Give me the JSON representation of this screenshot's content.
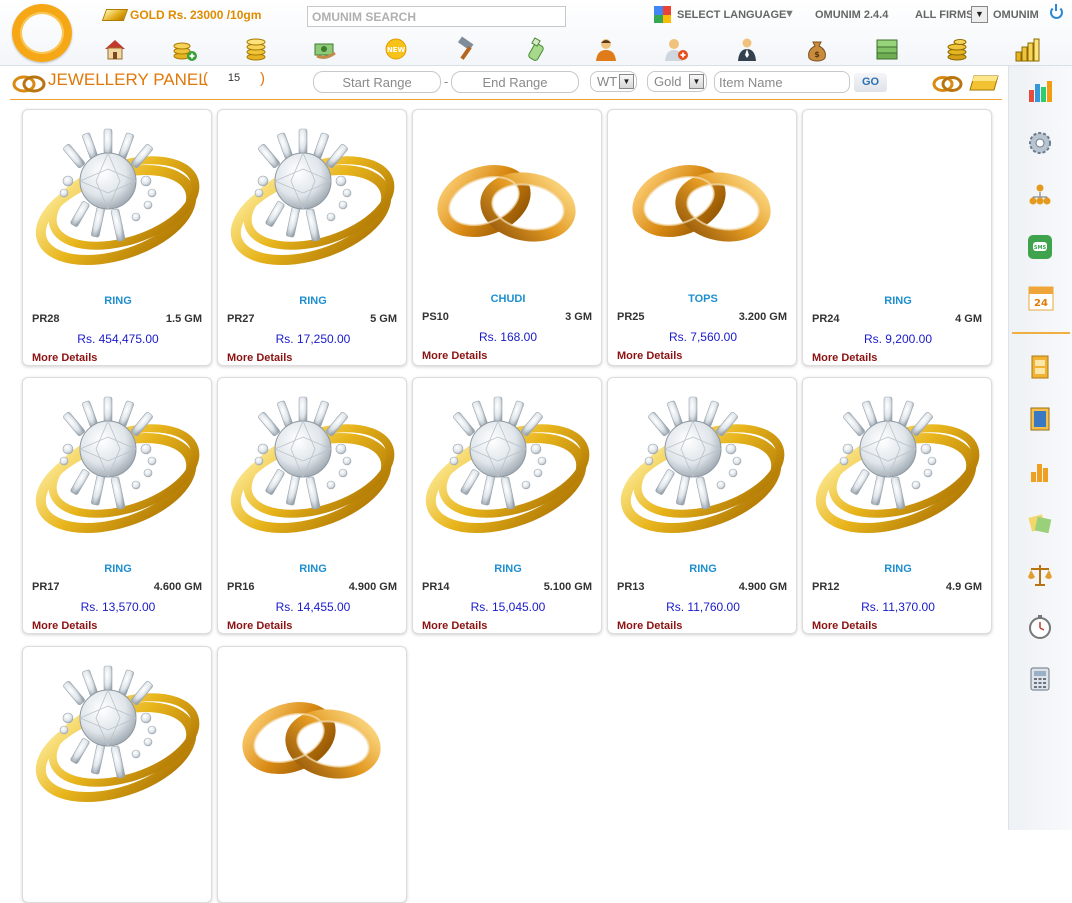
{
  "header": {
    "gold_rate": "GOLD Rs. 23000 /10gm",
    "search_placeholder": "OMUNIM SEARCH",
    "select_language": "SELECT LANGUAGE",
    "lang_arrow": "▼",
    "version": "OMUNIM 2.4.4",
    "firms": "ALL FIRMS",
    "firms_arrow": "▼",
    "user": "OMUNIM"
  },
  "nav_icons": [
    "home-icon",
    "gold-coins-add-icon",
    "gold-coins-icon",
    "payment-icon",
    "new-badge-icon",
    "hammer-icon",
    "money-bottle-icon",
    "customer-icon",
    "add-customer-icon",
    "staff-icon",
    "money-bag-icon",
    "cash-stack-icon",
    "coins-stack-icon",
    "gold-bars-chart-icon"
  ],
  "panel": {
    "title": "JEWELLERY PANEL",
    "count_open": "(",
    "count": "15",
    "count_close": ")",
    "start_range_placeholder": "Start Range",
    "range_sep": "-",
    "end_range_placeholder": "End Range",
    "wt_select": "WT",
    "metal_select": "Gold",
    "dd_arrow": "▼",
    "item_name_placeholder": "Item Name",
    "go_label": "GO"
  },
  "products": [
    {
      "image": "diamond-ring",
      "name": "RING",
      "code": "PR28",
      "weight": "1.5 GM",
      "price": "Rs. 454,475.00",
      "more": "More Details"
    },
    {
      "image": "diamond-ring",
      "name": "RING",
      "code": "PR27",
      "weight": "5 GM",
      "price": "Rs. 17,250.00",
      "more": "More Details"
    },
    {
      "image": "gold-bands",
      "name": "CHUDI",
      "code": "PS10",
      "weight": "3 GM",
      "price": "Rs. 168.00",
      "more": "More Details"
    },
    {
      "image": "gold-bands",
      "name": "TOPS",
      "code": "PR25",
      "weight": "3.200 GM",
      "price": "Rs. 7,560.00",
      "more": "More Details"
    },
    {
      "image": "none",
      "name": "RING",
      "code": "PR24",
      "weight": "4 GM",
      "price": "Rs. 9,200.00",
      "more": "More Details"
    },
    {
      "image": "diamond-ring",
      "name": "RING",
      "code": "PR17",
      "weight": "4.600 GM",
      "price": "Rs. 13,570.00",
      "more": "More Details"
    },
    {
      "image": "diamond-ring",
      "name": "RING",
      "code": "PR16",
      "weight": "4.900 GM",
      "price": "Rs. 14,455.00",
      "more": "More Details"
    },
    {
      "image": "diamond-ring",
      "name": "RING",
      "code": "PR14",
      "weight": "5.100 GM",
      "price": "Rs. 15,045.00",
      "more": "More Details"
    },
    {
      "image": "diamond-ring",
      "name": "RING",
      "code": "PR13",
      "weight": "4.900 GM",
      "price": "Rs. 11,760.00",
      "more": "More Details"
    },
    {
      "image": "diamond-ring",
      "name": "RING",
      "code": "PR12",
      "weight": "4.9 GM",
      "price": "Rs. 11,370.00",
      "more": "More Details"
    },
    {
      "image": "diamond-ring",
      "name": "",
      "code": "",
      "weight": "",
      "price": "",
      "more": ""
    },
    {
      "image": "gold-bands",
      "name": "",
      "code": "",
      "weight": "",
      "price": "",
      "more": ""
    }
  ],
  "sidebar_icons": [
    "bar-chart-icon",
    "settings-gear-icon",
    "org-chart-icon",
    "sms-icon",
    "calendar-icon",
    "film-icon",
    "film-strip-icon",
    "stats-icon",
    "notes-icon",
    "balance-scale-icon",
    "stopwatch-icon",
    "calculator-icon"
  ],
  "colors": {
    "accent_orange": "#e0780a",
    "product_name_blue": "#1e8fd0",
    "price_blue": "#1a1ac8",
    "more_details_red": "#8b1212",
    "gold": "#f6a716"
  }
}
